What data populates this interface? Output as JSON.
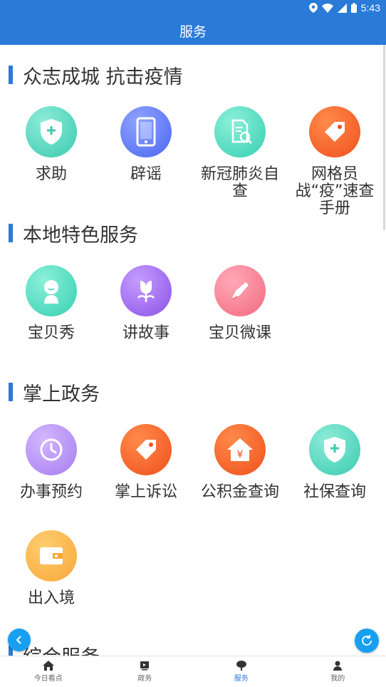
{
  "status_bar": {
    "time": "5:43"
  },
  "app_bar": {
    "title": "服务"
  },
  "sections": {
    "s1": {
      "title": "众志成城 抗击疫情"
    },
    "s2": {
      "title": "本地特色服务"
    },
    "s3": {
      "title": "掌上政务"
    },
    "s4": {
      "title": "综合服务"
    }
  },
  "items": {
    "help": "求助",
    "rumor": "辟谣",
    "selfcheck": "新冠肺炎自查",
    "gridbook": "网格员战“疫”速查手册",
    "babyshow": "宝贝秀",
    "story": "讲故事",
    "microclass": "宝贝微课",
    "appointment": "办事预约",
    "complaint": "掌上诉讼",
    "fund": "公积金查询",
    "social": "社保查询",
    "exit_entry": "出入境"
  },
  "bottom_nav": {
    "home": "今日看点",
    "gov": "政务",
    "service": "服务",
    "mine": "我的"
  },
  "colors": {
    "primary": "#2a7ad8",
    "fab": "#18a0f0"
  }
}
